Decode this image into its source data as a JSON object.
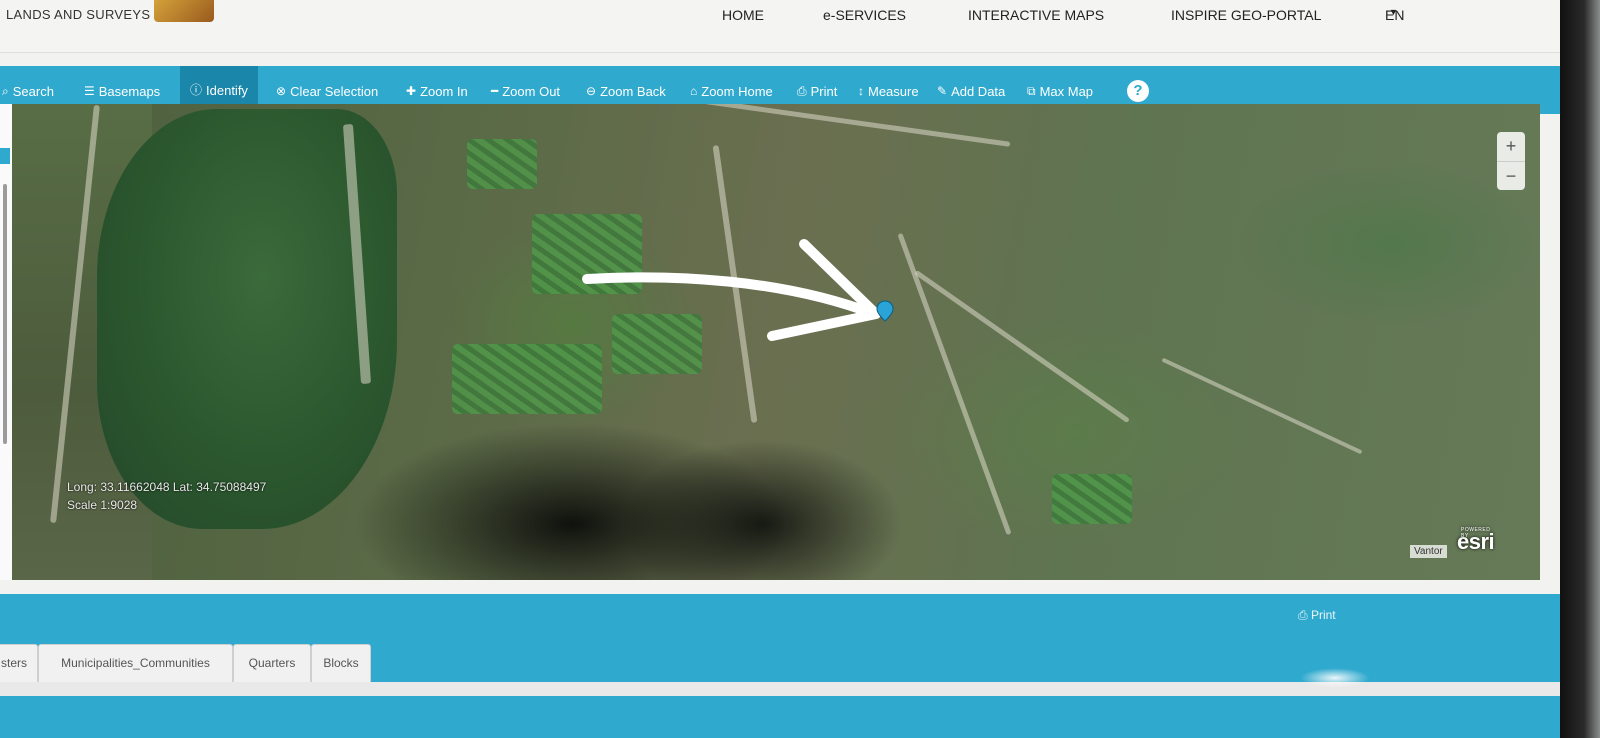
{
  "brand": {
    "text": "LANDS AND SURVEYS"
  },
  "topnav": {
    "home": "HOME",
    "eservices": "e-SERVICES",
    "interactive_maps": "INTERACTIVE MAPS",
    "inspire": "INSPIRE GEO-PORTAL",
    "lang": "EN"
  },
  "toolbar": {
    "search": "Search",
    "basemaps": "Basemaps",
    "identify": "Identify",
    "clear_selection": "Clear Selection",
    "zoom_in": "Zoom In",
    "zoom_out": "Zoom Out",
    "zoom_back": "Zoom Back",
    "zoom_home": "Zoom Home",
    "print": "Print",
    "measure": "Measure",
    "add_data": "Add Data",
    "max_map": "Max Map",
    "help": "?"
  },
  "map": {
    "zoom_in": "+",
    "zoom_out": "−",
    "coords": "Long: 33.11662048 Lat: 34.75088497",
    "scale": "Scale 1:9028",
    "attribution": "Vantor",
    "esri_powered": "POWERED BY",
    "esri": "esri"
  },
  "bottom": {
    "print": "Print",
    "tabs": [
      "sters",
      "Municipalities_Communities",
      "Quarters",
      "Blocks"
    ]
  },
  "colors": {
    "accent": "#2fa9cd",
    "active": "#1a86aa"
  }
}
